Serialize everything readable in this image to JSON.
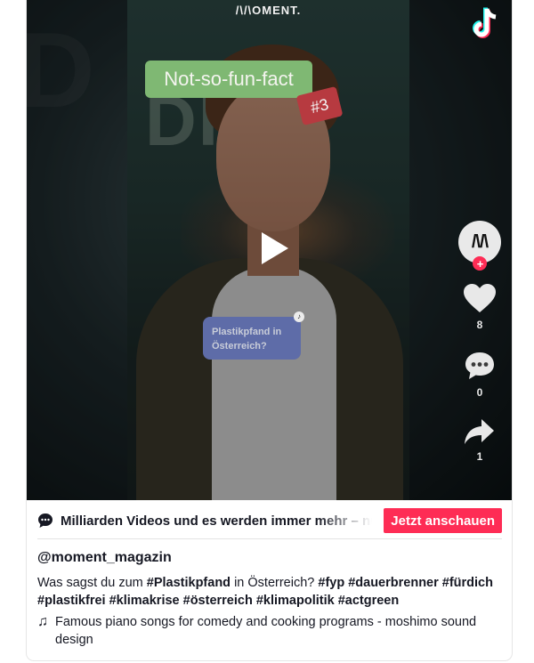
{
  "video": {
    "brand": "/\\/\\OMENT.",
    "label_main": "Not-so-fun-fact",
    "label_badge": "#3",
    "question_text": "Plastikpfand in Österreich?",
    "question_badge_icon": "tiktok-mini-icon"
  },
  "actions": {
    "avatar_text": "/\\/\\",
    "likes": "8",
    "comments": "0",
    "shares": "1"
  },
  "ticker": {
    "message": "Milliarden Videos und es werden immer mehr – nur auf TikTok",
    "cta_label": "Jetzt anschauen"
  },
  "post": {
    "username": "@moment_magazin",
    "caption_intro": "Was sagst du zum ",
    "caption_tag_main": "#Plastikpfand",
    "caption_middle": " in Österreich? ",
    "caption_tags": "#fyp #dauerbrenner #fürdich #plastikfrei #klimakrise #österreich #klimapolitik #actgreen",
    "music": "Famous piano songs for comedy and cooking programs - moshimo sound design"
  },
  "colors": {
    "accent": "#fe2c55",
    "green_label": "#7fb873",
    "red_badge": "#b73a40",
    "question_bg": "#5e6ca8"
  }
}
